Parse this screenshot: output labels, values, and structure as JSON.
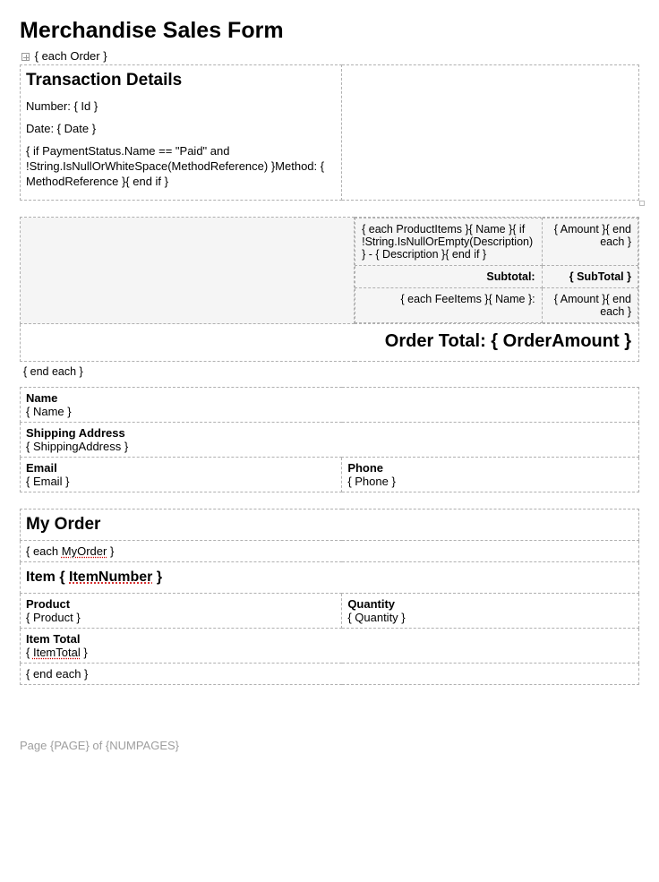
{
  "title": "Merchandise Sales Form",
  "each_order": "{ each Order }",
  "transaction": {
    "heading": "Transaction Details",
    "number_label": "Number: { Id }",
    "date_label": "Date: { Date }",
    "conditional_text": "{ if PaymentStatus.Name == \"Paid\" and !String.IsNullOrWhiteSpace(MethodReference) }Method: { MethodReference }{ end if }"
  },
  "items": {
    "product_line": "{ each ProductItems }{ Name }{ if !String.IsNullOrEmpty(Description) } - { Description }{ end if }",
    "product_amount": "{ Amount }{ end each }",
    "subtotal_label": "Subtotal:",
    "subtotal_value": "{ SubTotal }",
    "fee_line": "{ each FeeItems }{ Name }:",
    "fee_amount": "{ Amount }{ end each }"
  },
  "order_total": "Order Total: { OrderAmount }",
  "end_each": "{ end each }",
  "customer": {
    "name_label": "Name",
    "name_value": "{ Name }",
    "shipping_label": "Shipping Address",
    "shipping_value": "{ ShippingAddress }",
    "email_label": "Email",
    "email_value": "{ Email }",
    "phone_label": "Phone",
    "phone_value": "{ Phone }"
  },
  "myorder": {
    "heading": "My Order",
    "each_myorder": "{ each ",
    "each_myorder_link": "MyOrder",
    "each_myorder_close": " }",
    "item_heading_prefix": "Item { ",
    "item_heading_link": "ItemNumber",
    "item_heading_suffix": " }",
    "product_label": "Product",
    "product_value": "{ Product }",
    "quantity_label": "Quantity",
    "quantity_value": "{ Quantity }",
    "item_total_label": "Item Total",
    "item_total_value_open": "{ ",
    "item_total_value_link": "ItemTotal",
    "item_total_value_close": " }",
    "end_each": "{ end each }"
  },
  "footer": "Page {PAGE} of {NUMPAGES}"
}
